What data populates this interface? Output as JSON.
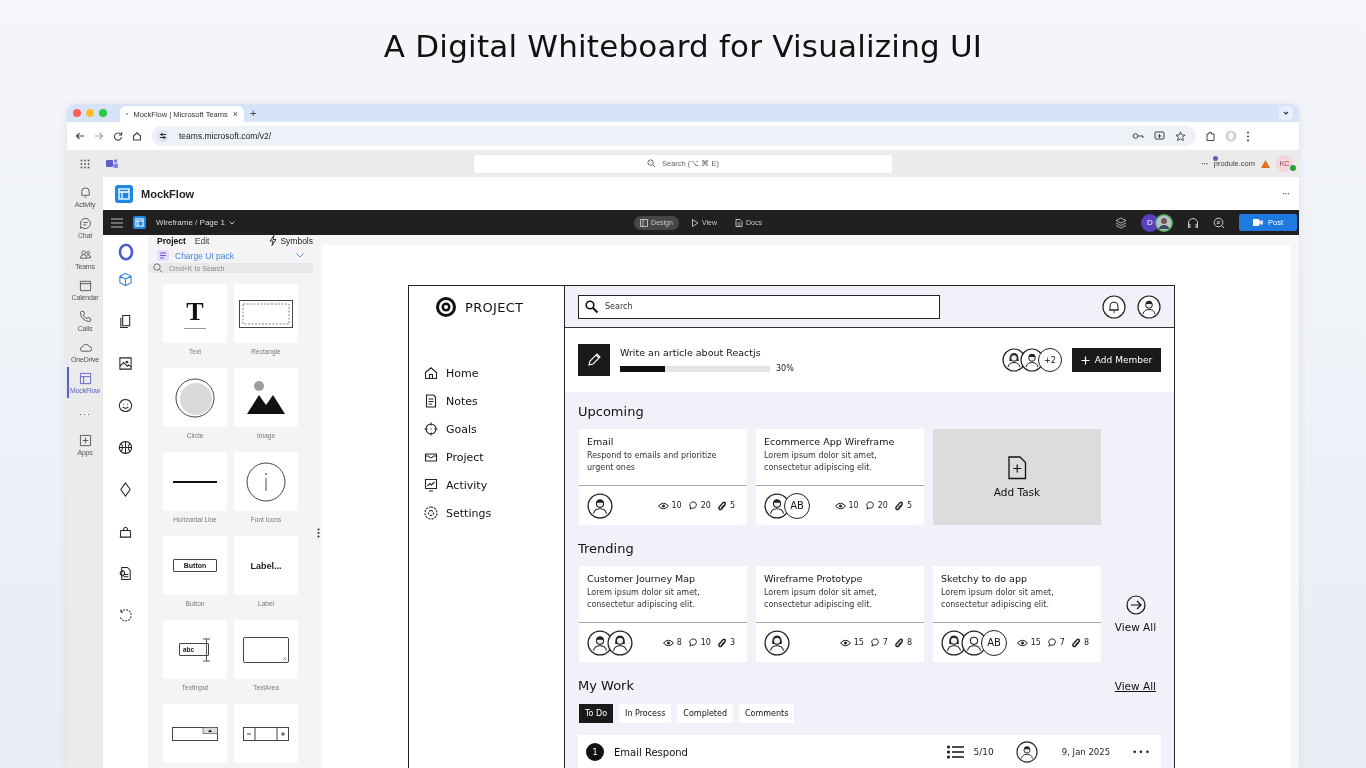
{
  "headline": "A Digital Whiteboard for Visualizing UI",
  "browser": {
    "tab_title": "MockFlow | Microsoft Teams",
    "tab_close": "×",
    "new_tab": "+",
    "url": "teams.microsoft.com/v2/"
  },
  "teams": {
    "search_placeholder": "Search (⌥ ⌘ E)",
    "more": "···",
    "org": "produle.com",
    "user_initials": "KC",
    "rail": [
      {
        "kind": "activity",
        "label": "Activity",
        "selected": false
      },
      {
        "kind": "chat",
        "label": "Chat",
        "selected": false
      },
      {
        "kind": "teams",
        "label": "Teams",
        "selected": false
      },
      {
        "kind": "calendar",
        "label": "Calendar",
        "selected": false
      },
      {
        "kind": "calls",
        "label": "Calls",
        "selected": false
      },
      {
        "kind": "onedrive",
        "label": "OneDrive",
        "selected": false
      },
      {
        "kind": "app",
        "label": "MockFlow",
        "selected": true
      },
      {
        "kind": "more",
        "label": "···",
        "selected": false
      },
      {
        "kind": "apps",
        "label": "Apps",
        "selected": false
      }
    ]
  },
  "app": {
    "name": "MockFlow",
    "more": "···"
  },
  "toolbar": {
    "breadcrumb": "Wireframe / Page 1",
    "modes": [
      {
        "kind": "design",
        "label": "Design",
        "selected": true
      },
      {
        "kind": "view",
        "label": "View",
        "selected": false
      },
      {
        "kind": "docs",
        "label": "Docs",
        "selected": false
      }
    ],
    "collaborator_initial": "D",
    "post": "Post"
  },
  "tools": [
    {
      "kind": "components",
      "selected": true
    },
    {
      "kind": "pages",
      "selected": false
    },
    {
      "kind": "images",
      "selected": false
    },
    {
      "kind": "emoji",
      "selected": false
    },
    {
      "kind": "ball",
      "selected": false
    },
    {
      "kind": "diamond",
      "selected": false
    },
    {
      "kind": "bag",
      "selected": false
    },
    {
      "kind": "file",
      "selected": false
    },
    {
      "kind": "history",
      "selected": false
    }
  ],
  "panel": {
    "tabs": [
      {
        "label": "Project",
        "selected": true
      },
      {
        "label": "Edit",
        "selected": false
      }
    ],
    "symbols": "Symbols",
    "pack": "Charge UI pack",
    "search_placeholder": "Cmd+K to Search",
    "components": [
      {
        "kind": "text",
        "label": "Text",
        "preview": "T"
      },
      {
        "kind": "rectangle",
        "label": "Rectangle"
      },
      {
        "kind": "circle",
        "label": "Circle"
      },
      {
        "kind": "image",
        "label": "Image"
      },
      {
        "kind": "line",
        "label": "Horizontal Line"
      },
      {
        "kind": "font_icons",
        "label": "Font Icons"
      },
      {
        "kind": "button",
        "label": "Button",
        "preview": "Button"
      },
      {
        "kind": "label",
        "label": "Label",
        "preview": "Label..."
      },
      {
        "kind": "text_input",
        "label": "TextInput",
        "preview": "abc"
      },
      {
        "kind": "text_area",
        "label": "TextArea"
      },
      {
        "kind": "numeric"
      },
      {
        "kind": "stepper"
      }
    ]
  },
  "wireframe": {
    "brand": "PROJECT",
    "nav": [
      {
        "kind": "home",
        "label": "Home"
      },
      {
        "kind": "notes",
        "label": "Notes"
      },
      {
        "kind": "goals",
        "label": "Goals"
      },
      {
        "kind": "project",
        "label": "Project"
      },
      {
        "kind": "activity",
        "label": "Activity"
      },
      {
        "kind": "settings",
        "label": "Settings"
      }
    ],
    "search_placeholder": "Search",
    "task": {
      "title": "Write an article about Reactjs",
      "level": 0.3,
      "percent": "30%",
      "members": [
        {
          "kind": "female"
        },
        {
          "kind": "male"
        }
      ],
      "extra_members": "+2",
      "add_member": "Add Member"
    },
    "upcoming": {
      "title": "Upcoming",
      "cards": [
        {
          "title": "Email",
          "text": "Respond to emails and prioritize urgent ones",
          "members": [
            {
              "kind": "male"
            }
          ],
          "views": "10",
          "comments": "20",
          "attachments": "5"
        },
        {
          "title": "Ecommerce App Wireframe",
          "text": "Lorem ipsum dolor sit amet, consectetur adipiscing elit.",
          "members": [
            {
              "kind": "male"
            },
            {
              "kind": "initials",
              "initials": "AB"
            }
          ],
          "views": "10",
          "comments": "20",
          "attachments": "5"
        }
      ],
      "add_task": "Add Task"
    },
    "trending": {
      "title": "Trending",
      "cards": [
        {
          "title": "Customer Journey Map",
          "text": "Lorem ipsum dolor sit amet, consectetur adipiscing elit.",
          "members": [
            {
              "kind": "male"
            },
            {
              "kind": "female"
            }
          ],
          "views": "8",
          "comments": "10",
          "attachments": "3"
        },
        {
          "title": "Wireframe Prototype",
          "text": "Lorem ipsum dolor sit amet, consectetur adipiscing elit.",
          "members": [
            {
              "kind": "female"
            }
          ],
          "views": "15",
          "comments": "7",
          "attachments": "8"
        },
        {
          "title": "Sketchy to do app",
          "text": "Lorem ipsum dolor sit amet, consectetur adipiscing elit.",
          "members": [
            {
              "kind": "female"
            },
            {
              "kind": "person"
            },
            {
              "kind": "initials",
              "initials": "AB"
            }
          ],
          "views": "15",
          "comments": "7",
          "attachments": "8"
        }
      ],
      "view_all": "View All"
    },
    "my_work": {
      "title": "My Work",
      "view_all": "View All",
      "tabs": [
        {
          "label": "To Do",
          "selected": true
        },
        {
          "label": "In Process",
          "selected": false
        },
        {
          "label": "Completed",
          "selected": false
        },
        {
          "label": "Comments",
          "selected": false
        }
      ],
      "rows": [
        {
          "number": "1",
          "title": "Email Respond",
          "progress": "5/10",
          "assignee": {
            "kind": "male"
          },
          "date": "9, Jan 2025",
          "more": "•••"
        }
      ]
    }
  }
}
